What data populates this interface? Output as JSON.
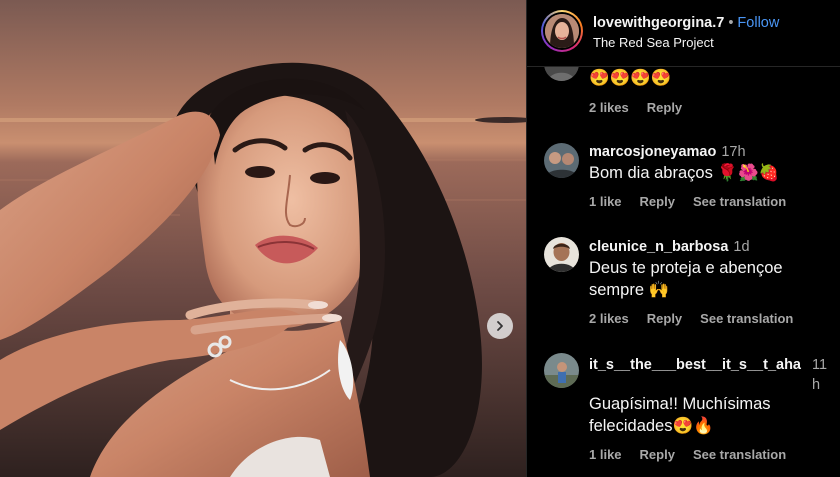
{
  "header": {
    "username": "lovewithgeorgina.7",
    "separator": "•",
    "follow_label": "Follow",
    "location": "The Red Sea Project"
  },
  "comments": [
    {
      "username": "",
      "time": "",
      "text": "😍😍😍😍",
      "likes": "2 likes",
      "reply": "Reply",
      "translation": ""
    },
    {
      "username": "marcosjoneyamao",
      "time": "17h",
      "text": "Bom dia abraços 🌹🌺🍓",
      "likes": "1 like",
      "reply": "Reply",
      "translation": "See translation"
    },
    {
      "username": "cleunice_n_barbosa",
      "time": "1d",
      "text": "Deus te proteja e abençoe sempre 🙌",
      "likes": "2 likes",
      "reply": "Reply",
      "translation": "See translation"
    },
    {
      "username": "it_s__the___best__it_s__t_aha",
      "time": "11h",
      "text": "Guapísima!! Muchísimas felecidades😍🔥",
      "likes": "1 like",
      "reply": "Reply",
      "translation": "See translation"
    }
  ],
  "colors": {
    "follow": "#4a96f5",
    "background": "#000000",
    "muted": "#a8a8a8"
  },
  "icons": {
    "carousel_next": "chevron-right-icon"
  }
}
